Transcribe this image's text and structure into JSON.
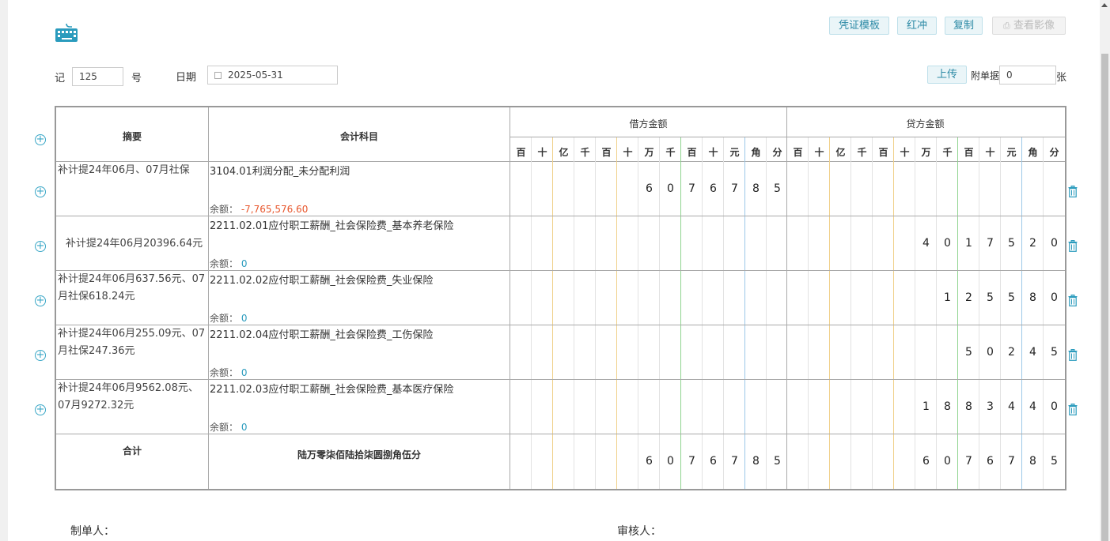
{
  "toolbar": {
    "template": "凭证模板",
    "reverse": "红冲",
    "copy": "复制",
    "view_image": "查看影像"
  },
  "header": {
    "ji_label": "记",
    "voucher_no": "125",
    "hao_label": "号",
    "date_label": "日期",
    "date_value": "2025-05-31",
    "upload": "上传",
    "attach_label": "附单据",
    "attach_count": "0",
    "zhang_label": "张"
  },
  "table": {
    "col_summary": "摘要",
    "col_subject": "会计科目",
    "col_debit": "借方金额",
    "col_credit": "贷方金额",
    "digit_headers": [
      "百",
      "十",
      "亿",
      "千",
      "百",
      "十",
      "万",
      "千",
      "百",
      "十",
      "元",
      "角",
      "分"
    ],
    "balance_label": "余额：",
    "rows": [
      {
        "summary": "补计提24年06月、07月社保",
        "subject": "3104.01利润分配_未分配利润",
        "balance": "-7,765,576.60",
        "debit": "6076785",
        "credit": ""
      },
      {
        "summary": "补计提24年06月20396.64元",
        "subject": "2211.02.01应付职工薪酬_社会保险费_基本养老保险",
        "balance": "0",
        "debit": "",
        "credit": "4017520"
      },
      {
        "summary": "补计提24年06月637.56元、07月社保618.24元",
        "subject": "2211.02.02应付职工薪酬_社会保险费_失业保险",
        "balance": "0",
        "debit": "",
        "credit": "125580"
      },
      {
        "summary": "补计提24年06月255.09元、07月社保247.36元",
        "subject": "2211.02.04应付职工薪酬_社会保险费_工伤保险",
        "balance": "0",
        "debit": "",
        "credit": "50245"
      },
      {
        "summary": "补计提24年06月9562.08元、07月9272.32元",
        "subject": "2211.02.03应付职工薪酬_社会保险费_基本医疗保险",
        "balance": "0",
        "debit": "",
        "credit": "1883440"
      }
    ],
    "total_label": "合计",
    "total_words": "陆万零柒佰陆拾柒圆捌角伍分",
    "total_debit": "6076785",
    "total_credit": "6076785"
  },
  "footer": {
    "maker_label": "制单人：",
    "reviewer_label": "审核人："
  },
  "colors": {
    "accent": "#2b89a5",
    "negative": "#e8562c",
    "line_yellow": "#f0d08a",
    "line_green": "#8fd48f",
    "line_blue": "#9cc8e8"
  }
}
